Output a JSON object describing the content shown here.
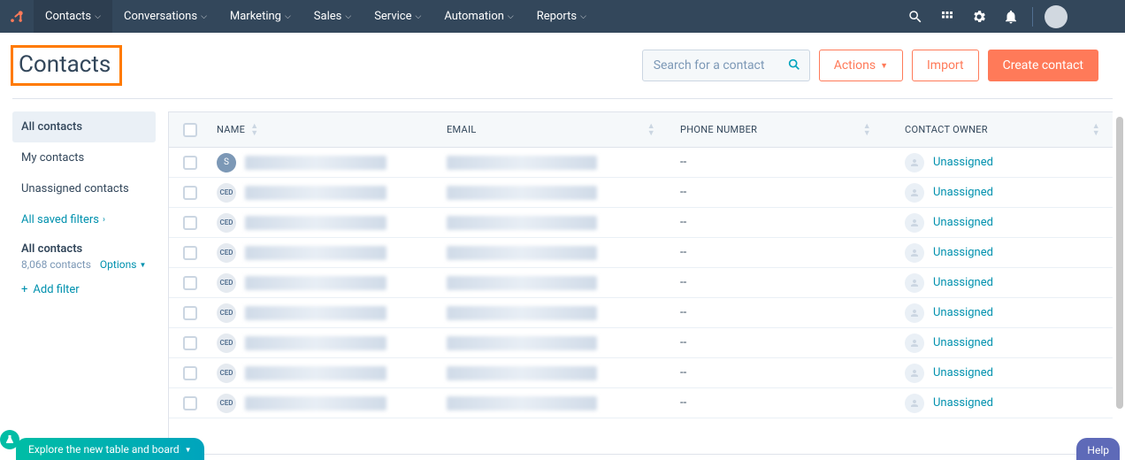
{
  "nav": {
    "items": [
      "Contacts",
      "Conversations",
      "Marketing",
      "Sales",
      "Service",
      "Automation",
      "Reports"
    ],
    "active_index": 0
  },
  "page": {
    "title": "Contacts",
    "search_placeholder": "Search for a contact",
    "actions_label": "Actions",
    "import_label": "Import",
    "create_label": "Create contact"
  },
  "sidebar": {
    "items": [
      {
        "label": "All contacts",
        "active": true
      },
      {
        "label": "My contacts"
      },
      {
        "label": "Unassigned contacts"
      }
    ],
    "saved_filters_label": "All saved filters",
    "group": {
      "title": "All contacts",
      "count_text": "8,068 contacts",
      "options_label": "Options"
    },
    "add_filter_label": "Add filter"
  },
  "table": {
    "columns": {
      "name": "NAME",
      "email": "EMAIL",
      "phone": "PHONE NUMBER",
      "owner": "CONTACT OWNER"
    },
    "rows": [
      {
        "avatar": "S",
        "avatar_type": "letter",
        "phone": "--",
        "owner": "Unassigned"
      },
      {
        "avatar": "CED",
        "avatar_type": "ced",
        "phone": "--",
        "owner": "Unassigned"
      },
      {
        "avatar": "CED",
        "avatar_type": "ced",
        "phone": "--",
        "owner": "Unassigned"
      },
      {
        "avatar": "CED",
        "avatar_type": "ced",
        "phone": "--",
        "owner": "Unassigned"
      },
      {
        "avatar": "CED",
        "avatar_type": "ced",
        "phone": "--",
        "owner": "Unassigned"
      },
      {
        "avatar": "CED",
        "avatar_type": "ced",
        "phone": "--",
        "owner": "Unassigned"
      },
      {
        "avatar": "CED",
        "avatar_type": "ced",
        "phone": "--",
        "owner": "Unassigned"
      },
      {
        "avatar": "CED",
        "avatar_type": "ced",
        "phone": "--",
        "owner": "Unassigned"
      },
      {
        "avatar": "CED",
        "avatar_type": "ced",
        "phone": "--",
        "owner": "Unassigned"
      }
    ]
  },
  "footer": {
    "explore_label": "Explore the new table and board",
    "help_label": "Help"
  },
  "colors": {
    "accent": "#ff7a59",
    "link": "#0091ae",
    "nav_bg": "#33475b"
  }
}
